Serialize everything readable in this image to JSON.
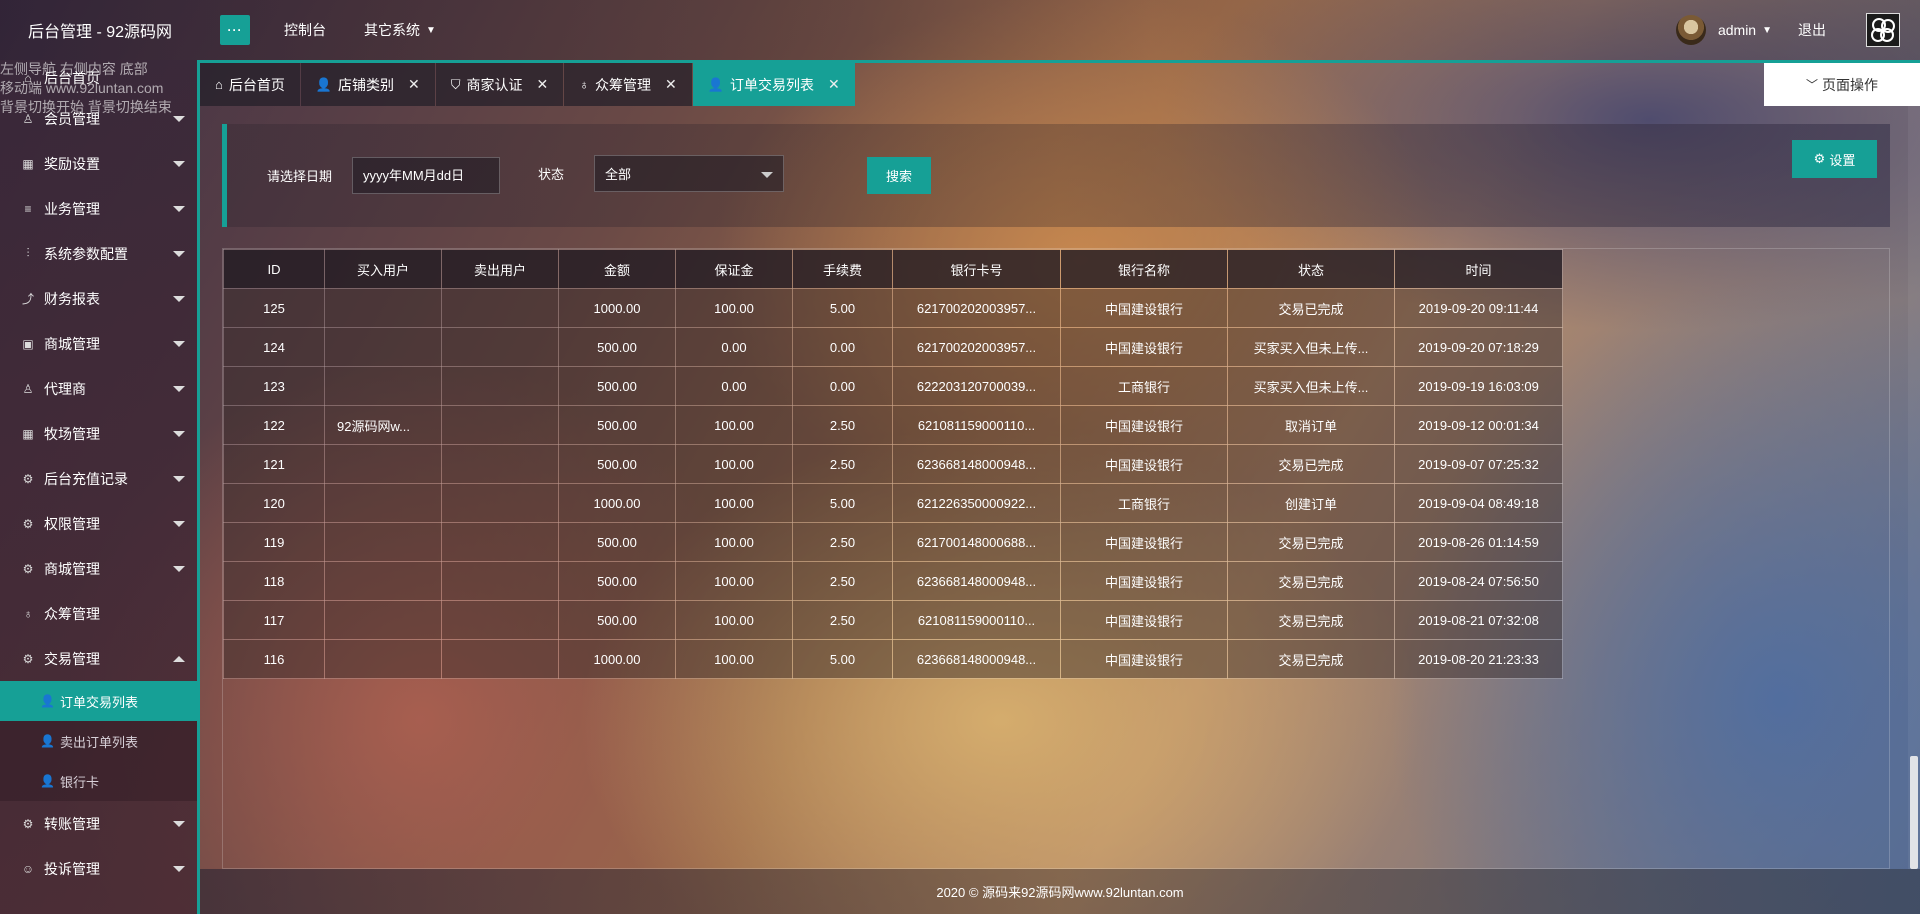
{
  "header": {
    "logo": "后台管理 - 92源码网",
    "menu_toggle": "···",
    "nav": [
      {
        "label": "控制台"
      },
      {
        "label": "其它系统"
      }
    ],
    "username": "admin",
    "logout": "退出"
  },
  "sidebar_overlay": [
    "左侧导航 右侧内容 底部",
    "移动端 www.92luntan.com",
    "背景切换开始 背景切换结束"
  ],
  "sidebar": {
    "first_item": "后台首页",
    "items": [
      {
        "label": "会员管理",
        "icon": "user-icon",
        "glyph": "♙"
      },
      {
        "label": "奖励设置",
        "icon": "gift-icon",
        "glyph": "▦"
      },
      {
        "label": "业务管理",
        "icon": "list-icon",
        "glyph": "≡"
      },
      {
        "label": "系统参数配置",
        "icon": "sliders-icon",
        "glyph": "⫶"
      },
      {
        "label": "财务报表",
        "icon": "chart-icon",
        "glyph": "⤴"
      },
      {
        "label": "商城管理",
        "icon": "store-icon",
        "glyph": "▣"
      },
      {
        "label": "代理商",
        "icon": "user-icon",
        "glyph": "♙"
      },
      {
        "label": "牧场管理",
        "icon": "gift-icon",
        "glyph": "▦"
      },
      {
        "label": "后台充值记录",
        "icon": "gear-icon",
        "glyph": "⚙"
      },
      {
        "label": "权限管理",
        "icon": "gear-icon",
        "glyph": "⚙"
      },
      {
        "label": "商城管理",
        "icon": "gear-icon",
        "glyph": "⚙"
      },
      {
        "label": "众筹管理",
        "icon": "drops-icon",
        "glyph": "♁"
      },
      {
        "label": "交易管理",
        "icon": "gear-icon",
        "glyph": "⚙"
      }
    ],
    "sub_items": [
      {
        "label": "订单交易列表"
      },
      {
        "label": "卖出订单列表"
      },
      {
        "label": "银行卡"
      }
    ],
    "bottom_items": [
      {
        "label": "转账管理"
      },
      {
        "label": "投诉管理"
      }
    ]
  },
  "tabs": [
    {
      "label": "后台首页"
    },
    {
      "label": "店铺类别"
    },
    {
      "label": "商家认证"
    },
    {
      "label": "众筹管理"
    },
    {
      "label": "订单交易列表"
    }
  ],
  "page_ops": "页面操作",
  "filter": {
    "date_label": "请选择日期",
    "date_placeholder": "yyyy年MM月dd日",
    "status_label": "状态",
    "status_value": "全部",
    "search": "搜索",
    "settings": "设置"
  },
  "table": {
    "columns": [
      "ID",
      "买入用户",
      "卖出用户",
      "金额",
      "保证金",
      "手续费",
      "银行卡号",
      "银行名称",
      "状态",
      "时间"
    ],
    "rows": [
      [
        "125",
        "",
        "",
        "1000.00",
        "100.00",
        "5.00",
        "621700202003957...",
        "中国建设银行",
        "交易已完成",
        "2019-09-20 09:11:44"
      ],
      [
        "124",
        "",
        "",
        "500.00",
        "0.00",
        "0.00",
        "621700202003957...",
        "中国建设银行",
        "买家买入但未上传...",
        "2019-09-20 07:18:29"
      ],
      [
        "123",
        "",
        "",
        "500.00",
        "0.00",
        "0.00",
        "622203120700039...",
        "工商银行",
        "买家买入但未上传...",
        "2019-09-19 16:03:09"
      ],
      [
        "122",
        "92源码网w...",
        "",
        "500.00",
        "100.00",
        "2.50",
        "621081159000110...",
        "中国建设银行",
        "取消订单",
        "2019-09-12 00:01:34"
      ],
      [
        "121",
        "",
        "",
        "500.00",
        "100.00",
        "2.50",
        "623668148000948...",
        "中国建设银行",
        "交易已完成",
        "2019-09-07 07:25:32"
      ],
      [
        "120",
        "",
        "",
        "1000.00",
        "100.00",
        "5.00",
        "621226350000922...",
        "工商银行",
        "创建订单",
        "2019-09-04 08:49:18"
      ],
      [
        "119",
        "",
        "",
        "500.00",
        "100.00",
        "2.50",
        "621700148000688...",
        "中国建设银行",
        "交易已完成",
        "2019-08-26 01:14:59"
      ],
      [
        "118",
        "",
        "",
        "500.00",
        "100.00",
        "2.50",
        "623668148000948...",
        "中国建设银行",
        "交易已完成",
        "2019-08-24 07:56:50"
      ],
      [
        "117",
        "",
        "",
        "500.00",
        "100.00",
        "2.50",
        "621081159000110...",
        "中国建设银行",
        "交易已完成",
        "2019-08-21 07:32:08"
      ],
      [
        "116",
        "",
        "",
        "1000.00",
        "100.00",
        "5.00",
        "623668148000948...",
        "中国建设银行",
        "交易已完成",
        "2019-08-20 21:23:33"
      ]
    ]
  },
  "footer": "2020 © 源码来92源码网www.92luntan.com",
  "colors": {
    "accent": "#16a096"
  }
}
